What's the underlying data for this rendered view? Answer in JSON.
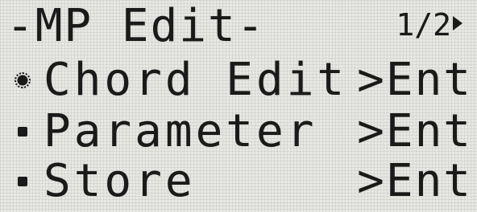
{
  "screen": {
    "title": "-MP Edit-",
    "page_indicator": "1/2",
    "page_arrow_icon": "right-triangle-icon"
  },
  "menu": {
    "items": [
      {
        "label": "Chord Edit",
        "action": ">Ent",
        "selected": true
      },
      {
        "label": "Parameter",
        "action": ">Ent",
        "selected": false
      },
      {
        "label": "Store",
        "action": ">Ent",
        "selected": false
      }
    ]
  },
  "colors": {
    "lcd_background": "#e7e7e3",
    "lcd_text": "#1a1a1a"
  }
}
